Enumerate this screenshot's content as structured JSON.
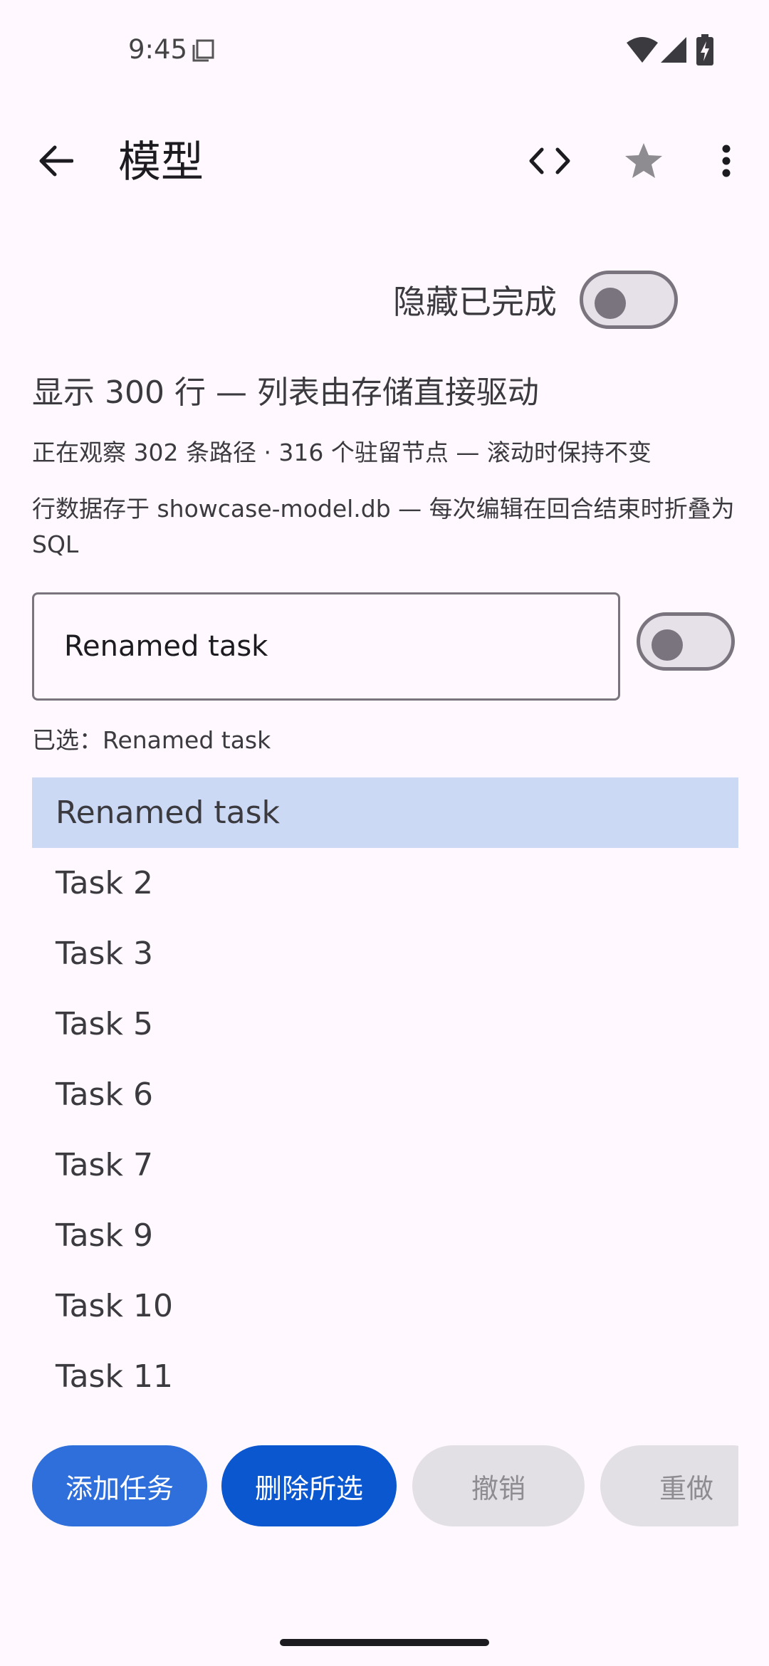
{
  "status_bar": {
    "time": "9:45",
    "icons": [
      "copy-icon",
      "wifi-icon",
      "signal-icon",
      "battery-charging-icon"
    ]
  },
  "app_bar": {
    "title": "模型",
    "icons": [
      "arrow-back-icon",
      "code-icon",
      "star-icon",
      "more-vert-icon"
    ]
  },
  "hide_completed": {
    "label": "隐藏已完成",
    "on": false
  },
  "info": {
    "heading": "显示 300 行 — 列表由存储直接驱动",
    "observing": "正在观察 302 条路径 · 316 个驻留节点 — 滚动时保持不变",
    "storage": "行数据存于 showcase-model.db — 每次编辑在回合结束时折叠为 SQL"
  },
  "editor": {
    "value": "Renamed task",
    "toggle_on": false
  },
  "selected_line": "已选：Renamed task",
  "tasks": [
    {
      "label": "Renamed task",
      "selected": true
    },
    {
      "label": "Task 2",
      "selected": false
    },
    {
      "label": "Task 3",
      "selected": false
    },
    {
      "label": "Task 5",
      "selected": false
    },
    {
      "label": "Task 6",
      "selected": false
    },
    {
      "label": "Task 7",
      "selected": false
    },
    {
      "label": "Task 9",
      "selected": false
    },
    {
      "label": "Task 10",
      "selected": false
    },
    {
      "label": "Task 11",
      "selected": false
    }
  ],
  "actions": {
    "add": "添加任务",
    "delete_selected": "删除所选",
    "undo": "撤销",
    "redo": "重做"
  },
  "colors": {
    "background": "#FFF8FE",
    "selected_row": "#CCD9F5",
    "primary": "#2F6FDB",
    "primary_dark": "#0B57D0",
    "disabled": "#E3E0E5"
  }
}
